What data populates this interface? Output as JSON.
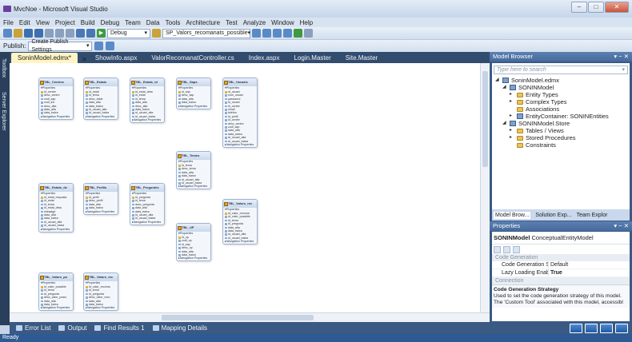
{
  "window": {
    "title": "MvcNoe - Microsoft Visual Studio"
  },
  "menu": [
    "File",
    "Edit",
    "View",
    "Project",
    "Build",
    "Debug",
    "Team",
    "Data",
    "Tools",
    "Architecture",
    "Test",
    "Analyze",
    "Window",
    "Help"
  ],
  "toolbar": {
    "config": "Debug",
    "target": "SP_Valors_recomanats_possible",
    "publish_label": "Publish:",
    "publish_value": "Create Publish Settings"
  },
  "side_tabs": [
    "Toolbox",
    "Server Explorer"
  ],
  "doc_tabs": [
    "SoninModel.edmx*",
    "ShowInfo.aspx",
    "ValorRecomanatController.cs",
    "Index.aspx",
    "Login.Master",
    "Site.Master"
  ],
  "entities": [
    {
      "name": "TBL_Centres",
      "sections": [
        {
          "label": "Properties",
          "items": [
            "id_centre",
            "desc_centre",
            "codi_sap",
            "codi_ine",
            "desc_alta",
            "data_alta",
            "data_baixa"
          ]
        },
        {
          "label": "Navigation Properties",
          "items": []
        }
      ]
    },
    {
      "name": "TBL_Estats",
      "sections": [
        {
          "label": "Properties",
          "items": [
            "id_estat",
            "id_tema",
            "desc_estat",
            "data_alta",
            "data_baixa",
            "id_usuari_alta",
            "id_usuari_baixa"
          ]
        },
        {
          "label": "Navigation Properties",
          "items": []
        }
      ]
    },
    {
      "name": "TBL_Estats_id",
      "sections": [
        {
          "label": "Properties",
          "items": [
            "id_estat_desc",
            "id_estat",
            "id_tema",
            "data_alta",
            "desc_alta",
            "data_baixa",
            "id_usuari_alta",
            "id_usuari_baixa"
          ]
        },
        {
          "label": "Navigation Properties",
          "items": []
        }
      ]
    },
    {
      "name": "TBL_Saps",
      "sections": [
        {
          "label": "Properties",
          "items": [
            "id_sap",
            "desc_sap",
            "data_alta",
            "data_baixa"
          ]
        },
        {
          "label": "Navigation Properties",
          "items": []
        }
      ]
    },
    {
      "name": "TBL_Usuaris",
      "sections": [
        {
          "label": "Properties",
          "items": [
            "id_usuari",
            "nom_usuari",
            "password",
            "id_usuari",
            "id_centre",
            "email",
            "telefon",
            "id_perfil",
            "id_centre",
            "desc_centre",
            "codi_sap",
            "data_alta",
            "data_baixa",
            "id_usuari_alta",
            "id_usuari_baixa"
          ]
        },
        {
          "label": "Navigation Properties",
          "items": []
        }
      ]
    },
    {
      "name": "TBL_Temes",
      "sections": [
        {
          "label": "Properties",
          "items": [
            "id_tema",
            "desc_tema",
            "data_alta",
            "data_baixa",
            "id_usuari_alta",
            "id_usuari_baixa"
          ]
        },
        {
          "label": "Navigation Properties",
          "items": []
        }
      ]
    },
    {
      "name": "TBL_Estats_de",
      "sections": [
        {
          "label": "Properties",
          "items": [
            "id_estat_resposta",
            "id_estat",
            "id_tema",
            "id_estat_desc",
            "missatge",
            "data_alta",
            "data_baixa",
            "id_usuari_alta",
            "id_usuari_baixa"
          ]
        },
        {
          "label": "Navigation Properties",
          "items": []
        }
      ]
    },
    {
      "name": "TBL_Perfils",
      "sections": [
        {
          "label": "Properties",
          "items": [
            "id_perfil",
            "desc_perfil",
            "data_alta",
            "data_baixa"
          ]
        },
        {
          "label": "Navigation Properties",
          "items": []
        }
      ]
    },
    {
      "name": "TBL_Preguntes",
      "sections": [
        {
          "label": "Properties",
          "items": [
            "id_pregunta",
            "id_tema",
            "desc_pregunta",
            "data_alta",
            "data_baixa",
            "id_usuari_alta",
            "id_usuari_baixa"
          ]
        },
        {
          "label": "Navigation Properties",
          "items": []
        }
      ]
    },
    {
      "name": "TBL_Valors_rec",
      "sections": [
        {
          "label": "Properties",
          "items": [
            "id_valor_recoma",
            "id_valor_possible",
            "id_tema",
            "id_pregunta",
            "data_alta",
            "data_baixa",
            "id_usuari_alta",
            "id_usuari_baixa"
          ]
        },
        {
          "label": "Navigation Properties",
          "items": []
        }
      ]
    },
    {
      "name": "TBL_UP",
      "sections": [
        {
          "label": "Properties",
          "items": [
            "id_up",
            "codi_up",
            "id_sap",
            "desc_up",
            "data_alta",
            "data_baixa"
          ]
        },
        {
          "label": "Navigation Properties",
          "items": []
        }
      ]
    },
    {
      "name": "TBL_Valors_po",
      "sections": [
        {
          "label": "Properties",
          "items": [
            "id_valor_possible",
            "id_tema",
            "id_pregunta",
            "desc_valor_possi",
            "data_alta",
            "data_baixa"
          ]
        },
        {
          "label": "Navigation Properties",
          "items": []
        }
      ]
    },
    {
      "name": "TBL_Valors_rec",
      "sections": [
        {
          "label": "Properties",
          "items": [
            "id_valor_recoma",
            "id_tema",
            "id_pregunta",
            "desc_valor_reco",
            "data_alta",
            "data_baixa"
          ]
        },
        {
          "label": "Navigation Properties",
          "items": []
        }
      ]
    }
  ],
  "bottom_tabs": [
    "Error List",
    "Output",
    "Find Results 1",
    "Mapping Details"
  ],
  "status": "Ready",
  "model_browser": {
    "title": "Model Browser",
    "search_placeholder": "Type here to search",
    "tree": [
      {
        "label": "SoninModel.edmx",
        "level": 0,
        "icon": "file"
      },
      {
        "label": "SONINModel",
        "level": 1,
        "icon": "db"
      },
      {
        "label": "Entity Types",
        "level": 2,
        "icon": "folder"
      },
      {
        "label": "Complex Types",
        "level": 2,
        "icon": "folder"
      },
      {
        "label": "Associations",
        "level": 2,
        "icon": "folder"
      },
      {
        "label": "EntityContainer: SONINEntities",
        "level": 2,
        "icon": "db"
      },
      {
        "label": "SONINModel.Store",
        "level": 1,
        "icon": "db"
      },
      {
        "label": "Tables / Views",
        "level": 2,
        "icon": "folder"
      },
      {
        "label": "Stored Procedures",
        "level": 2,
        "icon": "folder"
      },
      {
        "label": "Constraints",
        "level": 2,
        "icon": "folder"
      }
    ]
  },
  "panel_tabs": [
    "Model Brow...",
    "Solution Exp...",
    "Team Explor"
  ],
  "properties": {
    "title": "Properties",
    "object_name": "SONINModel",
    "object_type": "ConceptualEntityModel",
    "category1": "Code Generation",
    "rows": [
      {
        "key": "Code Generation Strate",
        "value": "Default"
      },
      {
        "key": "Lazy Loading Enabled",
        "value": "True"
      }
    ],
    "category2": "Connection",
    "desc_title": "Code Generation Strategy",
    "desc_text": "Used to set the code generation strategy of this model. The 'Custom Tool' associated with this model, accessibl"
  }
}
